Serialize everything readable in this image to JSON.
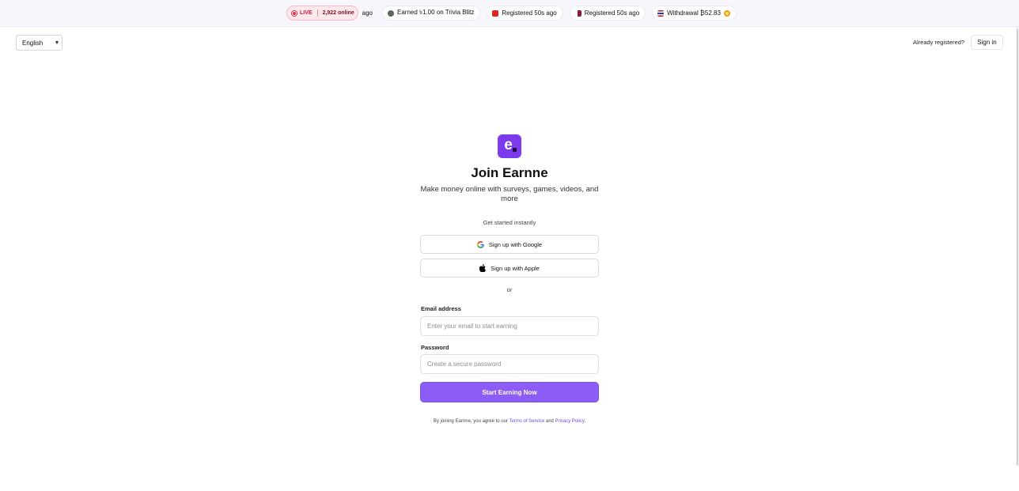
{
  "ticker": {
    "live_label": "LIVE",
    "online_count": "2,922 online",
    "ago_fragment": "ago",
    "items": [
      {
        "text": "Earned ৳1.00 on Trivia Blitz",
        "icon": "flag-icon",
        "color": "#5a6b5a"
      },
      {
        "text": "Registered 50s ago",
        "icon": "flag-icon",
        "color": "#e02424"
      },
      {
        "text": "Registered 50s ago",
        "icon": "flag-icon",
        "color": "#8b1c3b"
      },
      {
        "text": "Withdrawal ₿52.83",
        "icon": "flag-icon",
        "color": "#3b3b8f"
      }
    ]
  },
  "header": {
    "language": "English",
    "already_registered": "Already registered?",
    "sign_in": "Sign in"
  },
  "brand": {
    "logo_letter": "e",
    "accent": "#7c3aed"
  },
  "signup": {
    "title": "Join Earnne",
    "subtitle": "Make money online with surveys, games, videos, and more",
    "instant": "Get started instantly",
    "google_label": "Sign up with Google",
    "apple_label": "Sign up with Apple",
    "or": "or",
    "email_label": "Email address",
    "email_placeholder": "Enter your email to start earning",
    "email_value": "",
    "password_label": "Password",
    "password_placeholder": "Create a secure password",
    "password_value": "",
    "submit": "Start Earning Now",
    "legal_prefix": "By joining Earnne, you agree to our",
    "terms": "Terms of Service",
    "and": "and",
    "privacy": "Privacy Policy",
    "period": "."
  }
}
